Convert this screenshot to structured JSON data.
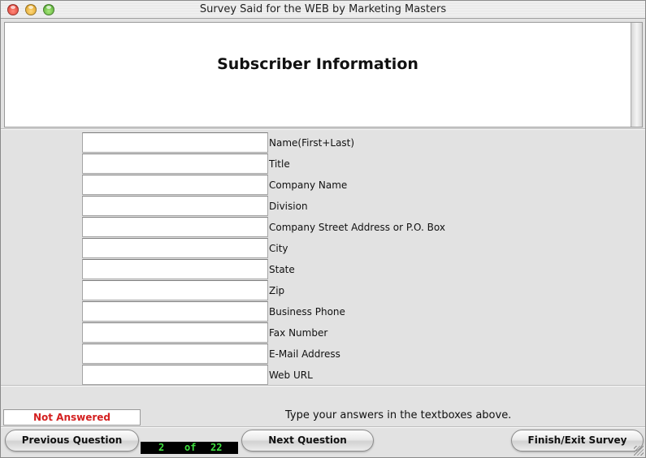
{
  "window": {
    "title": "Survey Said for the WEB by Marketing Masters"
  },
  "header": {
    "title": "Subscriber Information"
  },
  "form": {
    "fields": [
      {
        "label": "Name(First+Last)",
        "value": ""
      },
      {
        "label": "Title",
        "value": ""
      },
      {
        "label": "Company Name",
        "value": ""
      },
      {
        "label": "Division",
        "value": ""
      },
      {
        "label": "Company Street Address or P.O. Box",
        "value": ""
      },
      {
        "label": "City",
        "value": ""
      },
      {
        "label": "State",
        "value": ""
      },
      {
        "label": "Zip",
        "value": ""
      },
      {
        "label": "Business Phone",
        "value": ""
      },
      {
        "label": "Fax Number",
        "value": ""
      },
      {
        "label": "E-Mail Address",
        "value": ""
      },
      {
        "label": "Web URL",
        "value": ""
      }
    ]
  },
  "status": {
    "text": "Not Answered",
    "color": "#d42020"
  },
  "instruction": "Type your answers in the textboxes above.",
  "nav": {
    "previous_label": "Previous Question",
    "next_label": "Next Question",
    "finish_label": "Finish/Exit Survey"
  },
  "counter": {
    "current": "2",
    "of_label": "of",
    "total": "22"
  }
}
